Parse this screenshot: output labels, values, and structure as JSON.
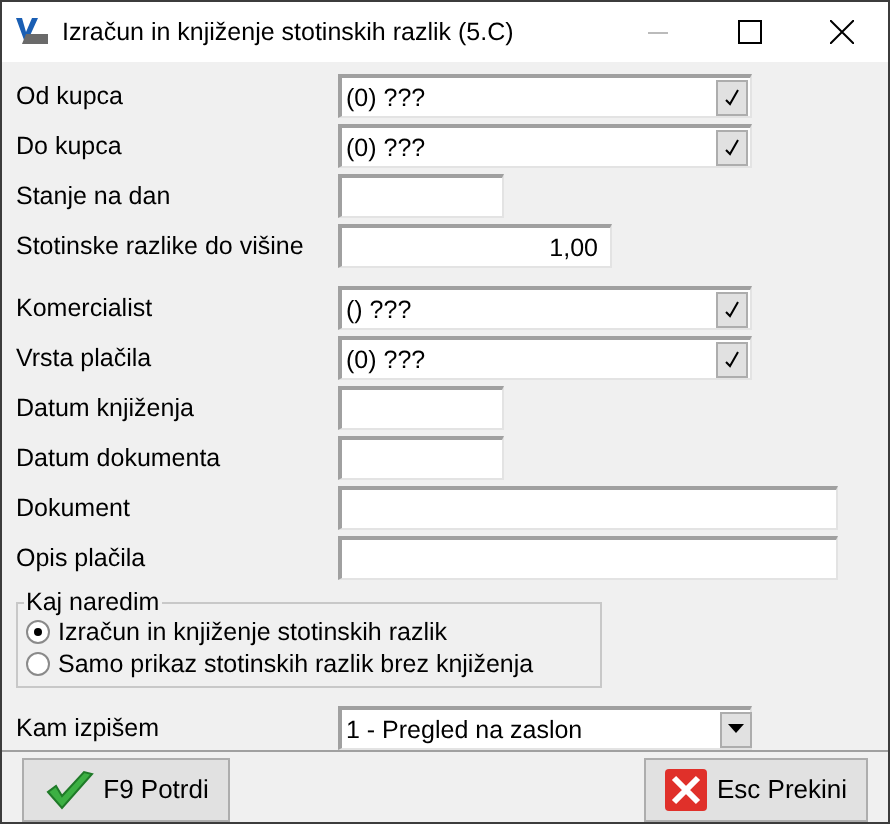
{
  "window": {
    "title": "Izračun in knjiženje stotinskih razlik  (5.C)"
  },
  "criteria": [
    {
      "label": "Od kupca",
      "kind": "lookup",
      "value": "(0) ???"
    },
    {
      "label": "Do kupca",
      "kind": "lookup",
      "value": "(0) ???"
    },
    {
      "label": "Stanje na dan",
      "kind": "short"
    },
    {
      "label": "Stotinske razlike do višine",
      "kind": "number",
      "value": "1,00"
    }
  ],
  "details": [
    {
      "label": "Komercialist",
      "kind": "lookup",
      "value": "() ???"
    },
    {
      "label": "Vrsta plačila",
      "kind": "lookup",
      "value": "(0) ???"
    },
    {
      "label": "Datum knjiženja",
      "kind": "short"
    },
    {
      "label": "Datum dokumenta",
      "kind": "short"
    },
    {
      "label": "Dokument",
      "kind": "long"
    },
    {
      "label": "Opis plačila",
      "kind": "long"
    }
  ],
  "action_group": {
    "title": "Kaj naredim",
    "options": [
      {
        "label": "Izračun in knjiženje stotinskih razlik",
        "selected": true
      },
      {
        "label": "Samo prikaz stotinskih razlik brez knjiženja",
        "selected": false
      }
    ]
  },
  "output": {
    "label": "Kam izpišem",
    "value": "1 - Pregled na zaslon"
  },
  "buttons": [
    {
      "label": "F9 Potrdi",
      "kind": "confirm"
    },
    {
      "label": "Esc Prekini",
      "kind": "cancel"
    }
  ]
}
